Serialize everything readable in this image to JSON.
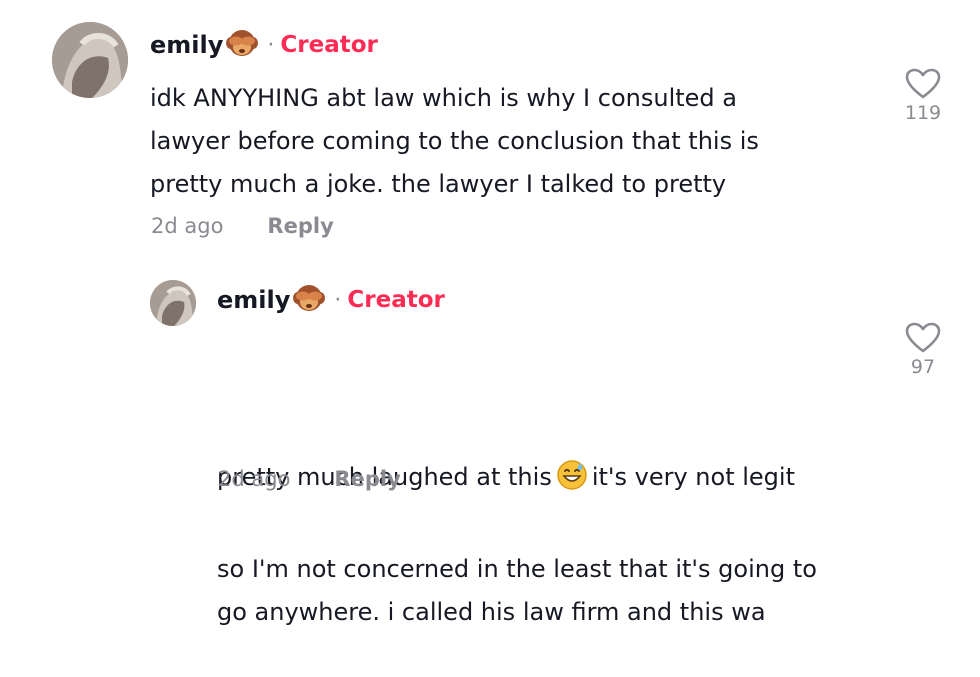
{
  "comments": [
    {
      "username": "emily",
      "emoji_icon": "see-no-evil-monkey-icon",
      "separator": "·",
      "badge": "Creator",
      "text": "idk ANYYHING abt law which is why I consulted a\nlawyer before coming to the conclusion that this is\npretty much a joke. the lawyer I talked to pretty",
      "time": "2d ago",
      "reply_label": "Reply",
      "like_count": "119"
    },
    {
      "username": "emily",
      "emoji_icon": "see-no-evil-monkey-icon",
      "separator": "·",
      "badge": "Creator",
      "text_before_emoji": "pretty much laughed at this",
      "inline_emoji_icon": "grinning-sweat-face-icon",
      "text_after_emoji": "it's very not legit",
      "text_rest": "so I'm not concerned in the least that it's going to\ngo anywhere. i called his law firm and this wa",
      "time": "2d ago",
      "reply_label": "Reply",
      "like_count": "97"
    }
  ],
  "colors": {
    "creator": "#fe2c55",
    "muted": "#8a8b91",
    "text": "#161823"
  }
}
